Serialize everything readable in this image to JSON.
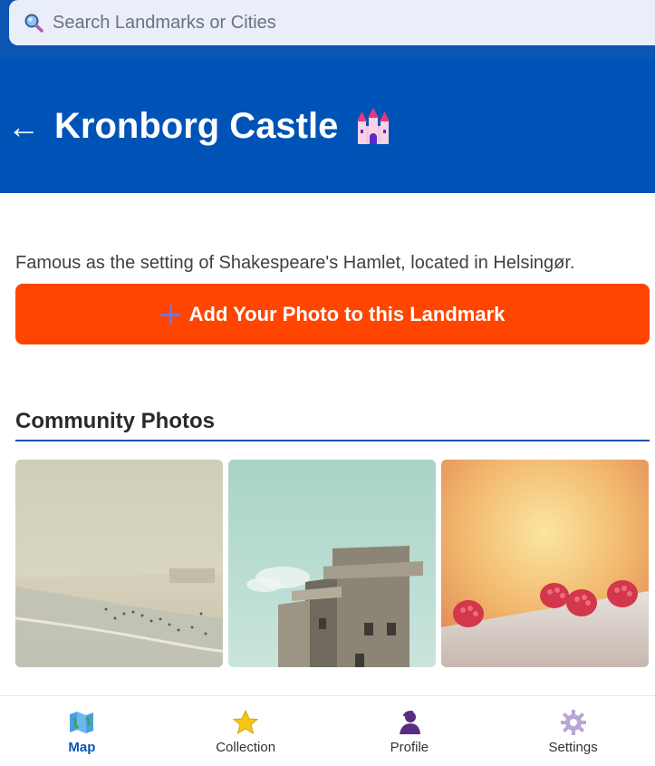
{
  "search": {
    "placeholder": "Search Landmarks or Cities",
    "icon": "search-icon"
  },
  "header": {
    "back_label": "←",
    "title": "Kronborg Castle",
    "title_icon": "castle-icon"
  },
  "description": "Famous as the setting of Shakespeare's Hamlet, located in Helsingør.",
  "cta": {
    "label": "Add Your Photo to this Landmark",
    "icon": "plus-icon"
  },
  "community": {
    "title": "Community Photos",
    "photos": [
      {
        "alt": "Beach scene",
        "icon": "photo-beach"
      },
      {
        "alt": "Bunker building",
        "icon": "photo-building"
      },
      {
        "alt": "Raspberries",
        "icon": "photo-raspberries"
      }
    ]
  },
  "nav": {
    "items": [
      {
        "label": "Map",
        "icon": "map-icon",
        "active": true
      },
      {
        "label": "Collection",
        "icon": "star-icon",
        "active": false
      },
      {
        "label": "Profile",
        "icon": "profile-icon",
        "active": false
      },
      {
        "label": "Settings",
        "icon": "gear-icon",
        "active": false
      }
    ]
  },
  "colors": {
    "header_blue": "#0053b6",
    "cta_orange": "#ff4500",
    "active_nav": "#0b55b5"
  }
}
